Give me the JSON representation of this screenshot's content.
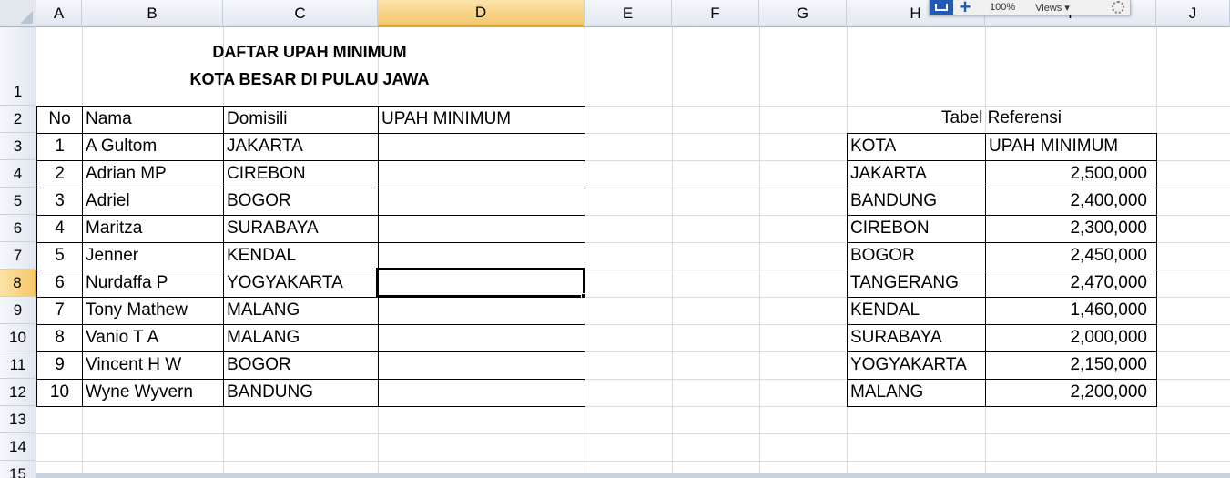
{
  "columns": [
    "A",
    "B",
    "C",
    "D",
    "E",
    "F",
    "G",
    "H",
    "I",
    "J"
  ],
  "rows": [
    "1",
    "2",
    "3",
    "4",
    "5",
    "6",
    "7",
    "8",
    "9",
    "10",
    "11",
    "12",
    "13",
    "14",
    "15"
  ],
  "selected_column": "D",
  "selected_row": "8",
  "title": {
    "line1": "DAFTAR UPAH MINIMUM",
    "line2": "KOTA BESAR DI PULAU JAWA"
  },
  "main_table": {
    "headers": [
      "No",
      "Nama",
      "Domisili",
      "UPAH MINIMUM"
    ],
    "rows": [
      [
        "1",
        "A Gultom",
        "JAKARTA",
        ""
      ],
      [
        "2",
        "Adrian MP",
        "CIREBON",
        ""
      ],
      [
        "3",
        "Adriel",
        "BOGOR",
        ""
      ],
      [
        "4",
        "Maritza",
        "SURABAYA",
        ""
      ],
      [
        "5",
        "Jenner",
        "KENDAL",
        ""
      ],
      [
        "6",
        "Nurdaffa P",
        "YOGYAKARTA",
        ""
      ],
      [
        "7",
        "Tony Mathew",
        "MALANG",
        ""
      ],
      [
        "8",
        "Vanio T A",
        "MALANG",
        ""
      ],
      [
        "9",
        "Vincent H W",
        "BOGOR",
        ""
      ],
      [
        "10",
        "Wyne Wyvern",
        "BANDUNG",
        ""
      ]
    ]
  },
  "ref_table": {
    "title": "Tabel Referensi",
    "headers": [
      "KOTA",
      "UPAH MINIMUM"
    ],
    "rows": [
      [
        "JAKARTA",
        "2,500,000"
      ],
      [
        "BANDUNG",
        "2,400,000"
      ],
      [
        "CIREBON",
        "2,300,000"
      ],
      [
        "BOGOR",
        "2,450,000"
      ],
      [
        "TANGERANG",
        "2,470,000"
      ],
      [
        "KENDAL",
        "1,460,000"
      ],
      [
        "SURABAYA",
        "2,000,000"
      ],
      [
        "YOGYAKARTA",
        "2,150,000"
      ],
      [
        "MALANG",
        "2,200,000"
      ]
    ]
  },
  "zoom_toolbar": {
    "zoom": "100%",
    "views_label": "Views ▾"
  }
}
